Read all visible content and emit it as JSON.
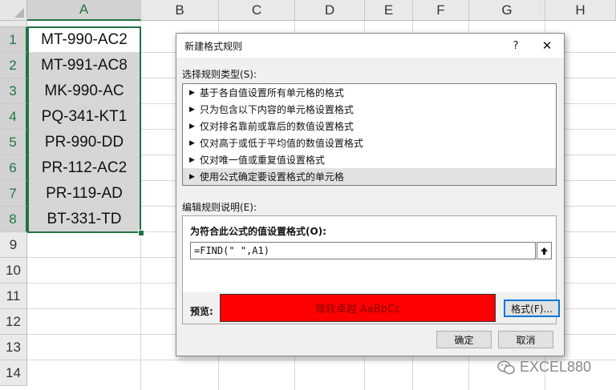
{
  "columns": [
    "A",
    "B",
    "C",
    "D",
    "E",
    "F",
    "G",
    "H"
  ],
  "rows": [
    "1",
    "2",
    "3",
    "4",
    "5",
    "6",
    "7",
    "8",
    "9",
    "10",
    "11",
    "12",
    "13",
    "14"
  ],
  "cells_a": [
    "MT-990-AC2",
    "MT-991-AC8",
    "MK-990-AC",
    "PQ-341-KT1",
    "PR-990-DD",
    "PR-112-AC2",
    "PR-119-AD",
    "BT-331-TD"
  ],
  "dialog": {
    "title": "新建格式规则",
    "help": "?",
    "close": "✕",
    "select_label": "选择规则类型(S):",
    "rule_types": [
      "基于各自值设置所有单元格的格式",
      "只为包含以下内容的单元格设置格式",
      "仅对排名靠前或靠后的数值设置格式",
      "仅对高于或低于平均值的数值设置格式",
      "仅对唯一值或重复值设置格式",
      "使用公式确定要设置格式的单元格"
    ],
    "selected_rule_index": 5,
    "edit_label": "编辑规则说明(E):",
    "formula_label": "为符合此公式的值设置格式(O):",
    "formula_value": "=FIND(\" \",A1)",
    "preview_label": "预览:",
    "preview_text": "微软卓越 AaBbCc",
    "preview_color": "#ff0000",
    "format_button": "格式(F)...",
    "ok_button": "确定",
    "cancel_button": "取消"
  },
  "watermark": "EXCEL880"
}
